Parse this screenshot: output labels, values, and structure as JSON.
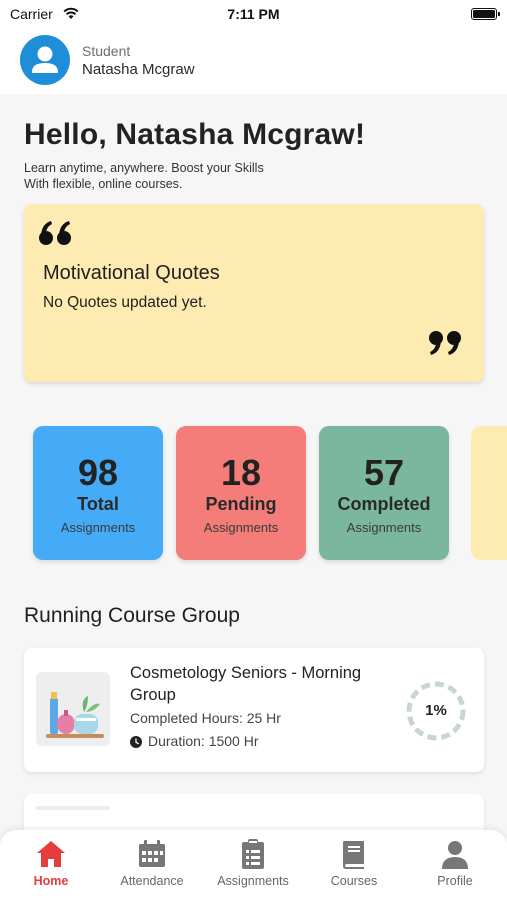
{
  "status_bar": {
    "carrier": "Carrier",
    "time": "7:11 PM"
  },
  "header": {
    "role": "Student",
    "name": "Natasha Mcgraw"
  },
  "greeting": "Hello, Natasha Mcgraw!",
  "tagline": [
    "Learn anytime, anywhere. Boost your Skills",
    "With flexible, online courses."
  ],
  "quotes": {
    "title": "Motivational Quotes",
    "text": "No Quotes updated yet."
  },
  "stats": [
    {
      "value": "98",
      "label": "Total",
      "sub": "Assignments",
      "color": "#46abf7"
    },
    {
      "value": "18",
      "label": "Pending",
      "sub": "Assignments",
      "color": "#f47c79"
    },
    {
      "value": "57",
      "label": "Completed",
      "sub": "Assignments",
      "color": "#7bb79f"
    }
  ],
  "section_title": "Running Course Group",
  "course": {
    "title": "Cosmetology Seniors - Morning Group",
    "completed_hours": "Completed Hours: 25 Hr",
    "duration": "Duration: 1500 Hr",
    "progress": "1%"
  },
  "nav": [
    {
      "label": "Home",
      "icon": "home-icon",
      "active": true
    },
    {
      "label": "Attendance",
      "icon": "calendar-icon",
      "active": false
    },
    {
      "label": "Assignments",
      "icon": "clipboard-icon",
      "active": false
    },
    {
      "label": "Courses",
      "icon": "book-icon",
      "active": false
    },
    {
      "label": "Profile",
      "icon": "user-icon",
      "active": false
    }
  ],
  "colors": {
    "accent": "#e53c3c",
    "quote_bg": "#fdebb1",
    "avatar": "#1f8ed8"
  }
}
